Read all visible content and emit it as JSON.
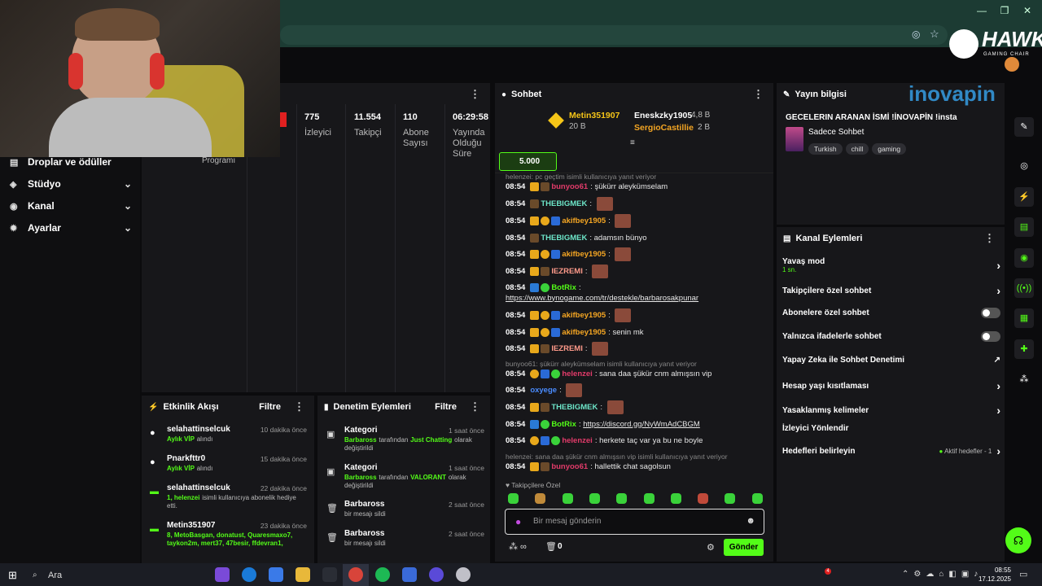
{
  "nav": [
    {
      "label": "Droplar ve ödüller",
      "icon": "gift-icon",
      "chevron": false
    },
    {
      "label": "Stüdyo",
      "icon": "studio-icon",
      "chevron": true
    },
    {
      "label": "Kanal",
      "icon": "channel-icon",
      "chevron": true
    },
    {
      "label": "Ayarlar",
      "icon": "gear-icon",
      "chevron": true
    }
  ],
  "stats_prog": "Programı",
  "stats": [
    {
      "value": "775",
      "label": "İzleyici"
    },
    {
      "value": "11.554",
      "label": "Takipçi"
    },
    {
      "value": "110",
      "label": "Abone Sayısı"
    },
    {
      "value": "06:29:58",
      "label": "Yayında Olduğu Süre"
    }
  ],
  "chat": {
    "title": "Sohbet",
    "top1": {
      "name": "Metin351907",
      "amount": "20 B"
    },
    "top2": {
      "name": "Eneskzky1905",
      "amount": "4,8 B"
    },
    "top3": {
      "name": "SergioCastillie",
      "amount": "2 B"
    },
    "goal": "5.000",
    "reply_top": "helenzei: pc geçtim isimli kullanıcıya yanıt veriyor",
    "messages": [
      {
        "time": "08:54",
        "user": "bunyoo61",
        "color": "#e23b6a",
        "text": "şükürr aleykümselam",
        "emote": false
      },
      {
        "time": "08:54",
        "user": "THEBIGMEK",
        "color": "#6de6c9",
        "text": "",
        "emote": true
      },
      {
        "time": "08:54",
        "user": "akifbey1905",
        "color": "#f5a623",
        "text": "",
        "emote": true
      },
      {
        "time": "08:54",
        "user": "THEBIGMEK",
        "color": "#6de6c9",
        "text": "adamsın bünyo",
        "emote": false
      },
      {
        "time": "08:54",
        "user": "akifbey1905",
        "color": "#f5a623",
        "text": "",
        "emote": true
      },
      {
        "time": "08:54",
        "user": "IEZREMI",
        "color": "#ff9a8a",
        "text": "",
        "emote": true
      },
      {
        "time": "08:54",
        "user": "BotRix",
        "color": "#53fc18",
        "text": "",
        "emote": false
      },
      {
        "time": "08:54",
        "user": "akifbey1905",
        "color": "#f5a623",
        "text": "",
        "emote": true
      },
      {
        "time": "08:54",
        "user": "akifbey1905",
        "color": "#f5a623",
        "text": "senin mk",
        "emote": false
      },
      {
        "time": "08:54",
        "user": "IEZREMI",
        "color": "#ff9a8a",
        "text": "",
        "emote": true
      }
    ],
    "botrix_link": "https://www.bynogame.com/tr/destekle/barbarosakpunar",
    "reply_mid": "bunyoo61: şükürr aleykümselam isimli kullanıcıya yanıt veriyor",
    "messages2": [
      {
        "time": "08:54",
        "user": "helenzei",
        "color": "#e23b6a",
        "text": "sana daa şükür cnm almışsın vip",
        "emote": false
      },
      {
        "time": "08:54",
        "user": "oxyege",
        "color": "#4a8cff",
        "text": "",
        "emote": true
      },
      {
        "time": "08:54",
        "user": "THEBIGMEK",
        "color": "#6de6c9",
        "text": "",
        "emote": true
      },
      {
        "time": "08:54",
        "user": "BotRix",
        "color": "#53fc18",
        "text": "",
        "emote": false
      },
      {
        "time": "08:54",
        "user": "helenzei",
        "color": "#e23b6a",
        "text": "herkete taç var ya bu ne boyle",
        "emote": false
      }
    ],
    "discord_link": "https://discord.gg/NyWmAdCBGM",
    "reply_bottom": "helenzei: sana daa şükür cnm almışsın vip isimli kullanıcıya yanıt veriyor",
    "last": {
      "time": "08:54",
      "user": "bunyoo61",
      "color": "#e23b6a",
      "text": "hallettik chat sagolsun"
    },
    "followers_only": "Takipçilere Özel",
    "placeholder": "Bir mesaj gönderin",
    "count": "0",
    "send": "Gönder"
  },
  "stream_info": {
    "title": "Yayın bilgisi",
    "stream_title": "GECELERIN ARANAN İSMİ !İNOVAPİN !insta",
    "category": "Sadece Sohbet",
    "tags": [
      "Turkish",
      "chill",
      "gaming"
    ]
  },
  "channel_actions": {
    "title": "Kanal Eylemleri",
    "items": [
      {
        "label": "Yavaş mod",
        "sub": "1 sn.",
        "control": "chevron"
      },
      {
        "label": "Takipçilere özel sohbet",
        "sub": "",
        "control": "chevron"
      },
      {
        "label": "Abonelere özel sohbet",
        "sub": "",
        "control": "toggle"
      },
      {
        "label": "Yalnızca ifadelerle sohbet",
        "sub": "",
        "control": "toggle"
      },
      {
        "label": "Yapay Zeka ile Sohbet Denetimi",
        "sub": "",
        "control": "external"
      },
      {
        "label": "Hesap yaşı kısıtlaması",
        "sub": "",
        "control": "chevron"
      },
      {
        "label": "Yasaklanmış kelimeler",
        "sub": "",
        "control": "chevron"
      },
      {
        "label": "İzleyici Yönlendir",
        "sub": "",
        "control": "none"
      },
      {
        "label": "Hedefleri belirleyin",
        "sub": "",
        "control": "chevron"
      }
    ],
    "goals_status": "Aktif hedefler - 1"
  },
  "activity": {
    "title": "Etkinlik Akışı",
    "filter": "Filtre",
    "items": [
      {
        "name": "selahattinselcuk",
        "time": "10 dakika önce",
        "desc": "Aylık VİP",
        "desc2": "alındı"
      },
      {
        "name": "Pnarkfttr0",
        "time": "15 dakika önce",
        "desc": "Aylık VİP",
        "desc2": "alındı"
      },
      {
        "name": "selahattinselcuk",
        "time": "22 dakika önce",
        "desc": "1, helenzei",
        "desc2": "isimli kullanıcıya abonelik hediye etti."
      },
      {
        "name": "Metin351907",
        "time": "23 dakika önce",
        "desc": "8, MetoBasgan, donatust, Quaresmaxo7, taykon2m, mert37, 47besir, ffdevran1,",
        "desc2": ""
      }
    ]
  },
  "moderation": {
    "title": "Denetim Eylemleri",
    "filter": "Filtre",
    "items": [
      {
        "name": "Kategori",
        "time": "1 saat önce",
        "who": "Barbaross",
        "mid": "tarafından",
        "cat": "Just Chatting",
        "tail": "olarak değiştirildi"
      },
      {
        "name": "Kategori",
        "time": "1 saat önce",
        "who": "Barbaross",
        "mid": "tarafından",
        "cat": "VALORANT",
        "tail": "olarak değiştirildi"
      },
      {
        "name": "Barbaross",
        "time": "2 saat önce",
        "who": "",
        "mid": "",
        "cat": "",
        "tail": "bir mesajı sildi"
      },
      {
        "name": "Barbaross",
        "time": "2 saat önce",
        "who": "",
        "mid": "",
        "cat": "",
        "tail": "bir mesajı sildi"
      }
    ]
  },
  "overlay": {
    "hawk": "HAWK",
    "hawk_sub": "GAMING CHAIR",
    "inovapin": "inovapin"
  },
  "taskbar": {
    "search": "Ara",
    "time": "08:55",
    "date": "17.12.2025",
    "notif": "4"
  },
  "colors": {
    "accent": "#53fc18",
    "panel": "#17171a",
    "chrome": "#1c3b33"
  }
}
